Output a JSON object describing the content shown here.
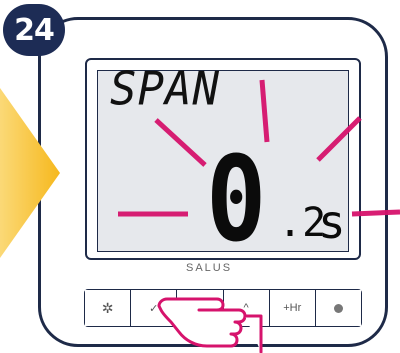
{
  "step": {
    "number": "24"
  },
  "display": {
    "title": "SPAN",
    "value": "0",
    "decimal": ".2",
    "unit": "s"
  },
  "brand": "SALUS",
  "buttons": [
    {
      "name": "settings-button",
      "label": "",
      "icon": "gear-icon"
    },
    {
      "name": "confirm-button",
      "label": "✓",
      "icon": "check-icon"
    },
    {
      "name": "down-button",
      "label": "",
      "icon": "chevron-down-icon"
    },
    {
      "name": "up-button",
      "label": "^",
      "icon": "chevron-up-icon"
    },
    {
      "name": "plus-hour-button",
      "label": "+Hr",
      "icon": ""
    },
    {
      "name": "power-button",
      "label": "",
      "icon": "power-icon"
    }
  ],
  "colors": {
    "badge": "#1d2c55",
    "arrow": "#f7c23b",
    "rays": "#d6136c",
    "outline": "#1e2a48",
    "lcd": "#e6e8ec"
  }
}
